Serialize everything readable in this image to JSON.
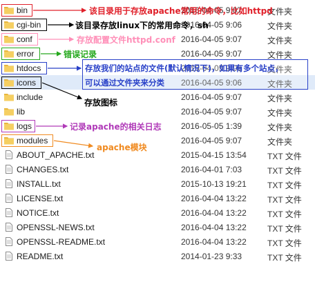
{
  "files": [
    {
      "name": "bin",
      "date": "2016-04-05 9:07",
      "type": "文件夹",
      "kind": "folder"
    },
    {
      "name": "cgi-bin",
      "date": "2016-04-05 9:06",
      "type": "文件夹",
      "kind": "folder"
    },
    {
      "name": "conf",
      "date": "2016-04-05 9:07",
      "type": "文件夹",
      "kind": "folder"
    },
    {
      "name": "error",
      "date": "2016-04-05 9:07",
      "type": "文件夹",
      "kind": "folder"
    },
    {
      "name": "htdocs",
      "date": "2016-04-05 9:06",
      "type": "文件夹",
      "kind": "folder"
    },
    {
      "name": "icons",
      "date": "2016-04-05 9:06",
      "type": "文件夹",
      "kind": "folder"
    },
    {
      "name": "include",
      "date": "2016-04-05 9:07",
      "type": "文件夹",
      "kind": "folder"
    },
    {
      "name": "lib",
      "date": "2016-04-05 9:07",
      "type": "文件夹",
      "kind": "folder"
    },
    {
      "name": "logs",
      "date": "2016-05-05 1:39",
      "type": "文件夹",
      "kind": "folder"
    },
    {
      "name": "modules",
      "date": "2016-04-05 9:07",
      "type": "文件夹",
      "kind": "folder"
    },
    {
      "name": "ABOUT_APACHE.txt",
      "date": "2015-04-15 13:54",
      "type": "TXT 文件",
      "kind": "txt"
    },
    {
      "name": "CHANGES.txt",
      "date": "2016-04-01 7:03",
      "type": "TXT 文件",
      "kind": "txt"
    },
    {
      "name": "INSTALL.txt",
      "date": "2015-10-13 19:21",
      "type": "TXT 文件",
      "kind": "txt"
    },
    {
      "name": "LICENSE.txt",
      "date": "2016-04-04 13:22",
      "type": "TXT 文件",
      "kind": "txt"
    },
    {
      "name": "NOTICE.txt",
      "date": "2016-04-04 13:22",
      "type": "TXT 文件",
      "kind": "txt"
    },
    {
      "name": "OPENSSL-NEWS.txt",
      "date": "2016-04-04 13:22",
      "type": "TXT 文件",
      "kind": "txt"
    },
    {
      "name": "OPENSSL-README.txt",
      "date": "2016-04-04 13:22",
      "type": "TXT 文件",
      "kind": "txt"
    },
    {
      "name": "README.txt",
      "date": "2014-01-23 9:33",
      "type": "TXT 文件",
      "kind": "txt"
    }
  ],
  "annotations": {
    "bin": "该目录用于存放apache常用的命令，比如httpd",
    "cgi_bin": "该目录存放linux下的常用命令，sh",
    "conf": "存放配置文件httpd.conf",
    "error": "错误记录",
    "htdocs_line1": "存放我们的站点的文件(默认情况下)，如果有多个站点，",
    "htdocs_line2": "可以通过文件夹来分类",
    "icons": "存放图标",
    "logs": "记录apache的相关日志",
    "modules": "apache模块"
  },
  "colors": {
    "bin": "#e0202a",
    "cgi_bin": "#000000",
    "conf": "#ff8fb8",
    "error": "#24a81c",
    "htdocs": "#2840c8",
    "icons": "#000000",
    "logs": "#b03ab8",
    "modules": "#f08a20",
    "folder": "#f1c54e",
    "selected_row": "#dfeaf9"
  }
}
